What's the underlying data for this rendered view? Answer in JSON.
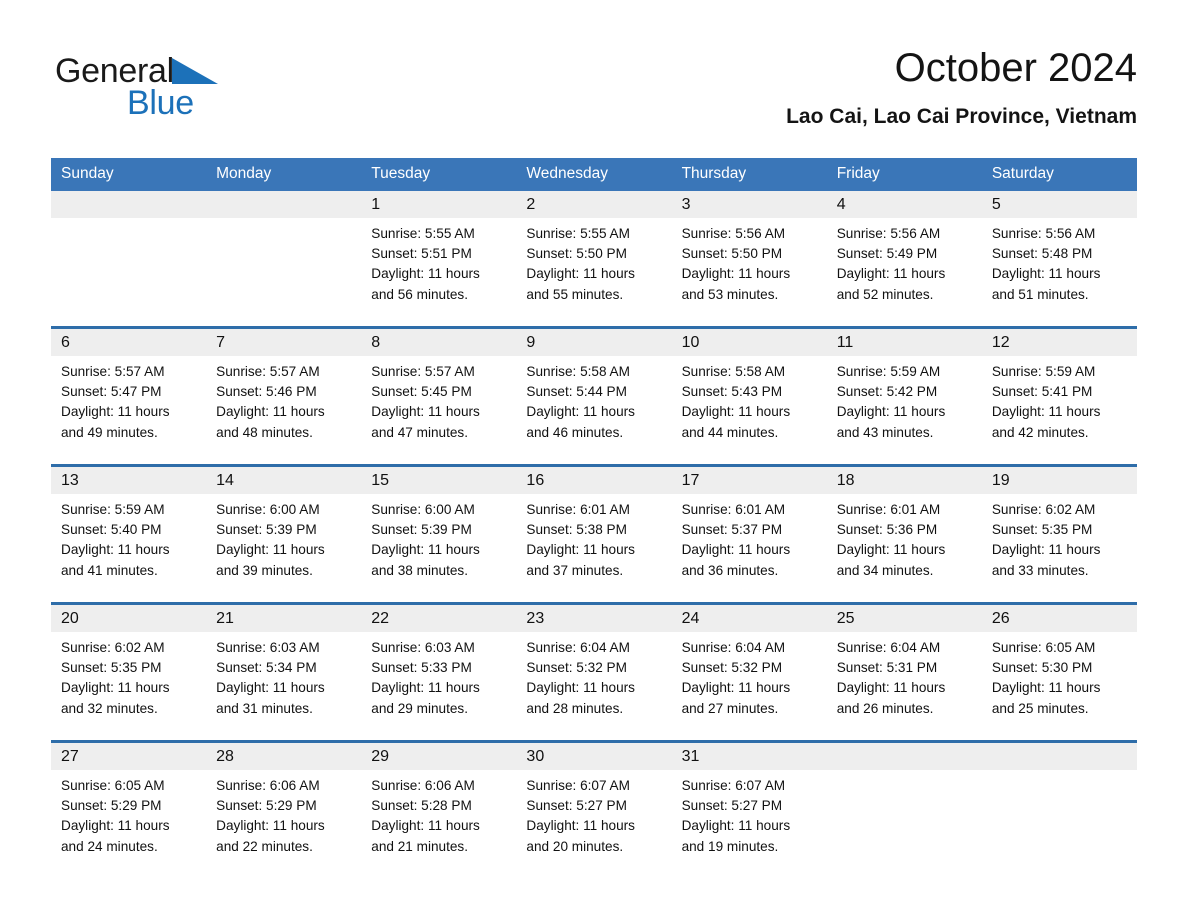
{
  "brand": {
    "name_part1": "General",
    "name_part2": "Blue",
    "logo_icon": "triangle-flag-icon",
    "accent_color": "#1c71b9"
  },
  "header": {
    "month_title": "October 2024",
    "location": "Lao Cai, Lao Cai Province, Vietnam"
  },
  "colors": {
    "header_blue": "#3a76b8",
    "row_divider_blue": "#2e6da9",
    "date_band_gray": "#eeeeee",
    "text": "#111111"
  },
  "weekdays": [
    "Sunday",
    "Monday",
    "Tuesday",
    "Wednesday",
    "Thursday",
    "Friday",
    "Saturday"
  ],
  "weeks": [
    [
      {
        "day": "",
        "lines": []
      },
      {
        "day": "",
        "lines": []
      },
      {
        "day": "1",
        "lines": [
          "Sunrise: 5:55 AM",
          "Sunset: 5:51 PM",
          "Daylight: 11 hours",
          "and 56 minutes."
        ]
      },
      {
        "day": "2",
        "lines": [
          "Sunrise: 5:55 AM",
          "Sunset: 5:50 PM",
          "Daylight: 11 hours",
          "and 55 minutes."
        ]
      },
      {
        "day": "3",
        "lines": [
          "Sunrise: 5:56 AM",
          "Sunset: 5:50 PM",
          "Daylight: 11 hours",
          "and 53 minutes."
        ]
      },
      {
        "day": "4",
        "lines": [
          "Sunrise: 5:56 AM",
          "Sunset: 5:49 PM",
          "Daylight: 11 hours",
          "and 52 minutes."
        ]
      },
      {
        "day": "5",
        "lines": [
          "Sunrise: 5:56 AM",
          "Sunset: 5:48 PM",
          "Daylight: 11 hours",
          "and 51 minutes."
        ]
      }
    ],
    [
      {
        "day": "6",
        "lines": [
          "Sunrise: 5:57 AM",
          "Sunset: 5:47 PM",
          "Daylight: 11 hours",
          "and 49 minutes."
        ]
      },
      {
        "day": "7",
        "lines": [
          "Sunrise: 5:57 AM",
          "Sunset: 5:46 PM",
          "Daylight: 11 hours",
          "and 48 minutes."
        ]
      },
      {
        "day": "8",
        "lines": [
          "Sunrise: 5:57 AM",
          "Sunset: 5:45 PM",
          "Daylight: 11 hours",
          "and 47 minutes."
        ]
      },
      {
        "day": "9",
        "lines": [
          "Sunrise: 5:58 AM",
          "Sunset: 5:44 PM",
          "Daylight: 11 hours",
          "and 46 minutes."
        ]
      },
      {
        "day": "10",
        "lines": [
          "Sunrise: 5:58 AM",
          "Sunset: 5:43 PM",
          "Daylight: 11 hours",
          "and 44 minutes."
        ]
      },
      {
        "day": "11",
        "lines": [
          "Sunrise: 5:59 AM",
          "Sunset: 5:42 PM",
          "Daylight: 11 hours",
          "and 43 minutes."
        ]
      },
      {
        "day": "12",
        "lines": [
          "Sunrise: 5:59 AM",
          "Sunset: 5:41 PM",
          "Daylight: 11 hours",
          "and 42 minutes."
        ]
      }
    ],
    [
      {
        "day": "13",
        "lines": [
          "Sunrise: 5:59 AM",
          "Sunset: 5:40 PM",
          "Daylight: 11 hours",
          "and 41 minutes."
        ]
      },
      {
        "day": "14",
        "lines": [
          "Sunrise: 6:00 AM",
          "Sunset: 5:39 PM",
          "Daylight: 11 hours",
          "and 39 minutes."
        ]
      },
      {
        "day": "15",
        "lines": [
          "Sunrise: 6:00 AM",
          "Sunset: 5:39 PM",
          "Daylight: 11 hours",
          "and 38 minutes."
        ]
      },
      {
        "day": "16",
        "lines": [
          "Sunrise: 6:01 AM",
          "Sunset: 5:38 PM",
          "Daylight: 11 hours",
          "and 37 minutes."
        ]
      },
      {
        "day": "17",
        "lines": [
          "Sunrise: 6:01 AM",
          "Sunset: 5:37 PM",
          "Daylight: 11 hours",
          "and 36 minutes."
        ]
      },
      {
        "day": "18",
        "lines": [
          "Sunrise: 6:01 AM",
          "Sunset: 5:36 PM",
          "Daylight: 11 hours",
          "and 34 minutes."
        ]
      },
      {
        "day": "19",
        "lines": [
          "Sunrise: 6:02 AM",
          "Sunset: 5:35 PM",
          "Daylight: 11 hours",
          "and 33 minutes."
        ]
      }
    ],
    [
      {
        "day": "20",
        "lines": [
          "Sunrise: 6:02 AM",
          "Sunset: 5:35 PM",
          "Daylight: 11 hours",
          "and 32 minutes."
        ]
      },
      {
        "day": "21",
        "lines": [
          "Sunrise: 6:03 AM",
          "Sunset: 5:34 PM",
          "Daylight: 11 hours",
          "and 31 minutes."
        ]
      },
      {
        "day": "22",
        "lines": [
          "Sunrise: 6:03 AM",
          "Sunset: 5:33 PM",
          "Daylight: 11 hours",
          "and 29 minutes."
        ]
      },
      {
        "day": "23",
        "lines": [
          "Sunrise: 6:04 AM",
          "Sunset: 5:32 PM",
          "Daylight: 11 hours",
          "and 28 minutes."
        ]
      },
      {
        "day": "24",
        "lines": [
          "Sunrise: 6:04 AM",
          "Sunset: 5:32 PM",
          "Daylight: 11 hours",
          "and 27 minutes."
        ]
      },
      {
        "day": "25",
        "lines": [
          "Sunrise: 6:04 AM",
          "Sunset: 5:31 PM",
          "Daylight: 11 hours",
          "and 26 minutes."
        ]
      },
      {
        "day": "26",
        "lines": [
          "Sunrise: 6:05 AM",
          "Sunset: 5:30 PM",
          "Daylight: 11 hours",
          "and 25 minutes."
        ]
      }
    ],
    [
      {
        "day": "27",
        "lines": [
          "Sunrise: 6:05 AM",
          "Sunset: 5:29 PM",
          "Daylight: 11 hours",
          "and 24 minutes."
        ]
      },
      {
        "day": "28",
        "lines": [
          "Sunrise: 6:06 AM",
          "Sunset: 5:29 PM",
          "Daylight: 11 hours",
          "and 22 minutes."
        ]
      },
      {
        "day": "29",
        "lines": [
          "Sunrise: 6:06 AM",
          "Sunset: 5:28 PM",
          "Daylight: 11 hours",
          "and 21 minutes."
        ]
      },
      {
        "day": "30",
        "lines": [
          "Sunrise: 6:07 AM",
          "Sunset: 5:27 PM",
          "Daylight: 11 hours",
          "and 20 minutes."
        ]
      },
      {
        "day": "31",
        "lines": [
          "Sunrise: 6:07 AM",
          "Sunset: 5:27 PM",
          "Daylight: 11 hours",
          "and 19 minutes."
        ]
      },
      {
        "day": "",
        "lines": []
      },
      {
        "day": "",
        "lines": []
      }
    ]
  ]
}
